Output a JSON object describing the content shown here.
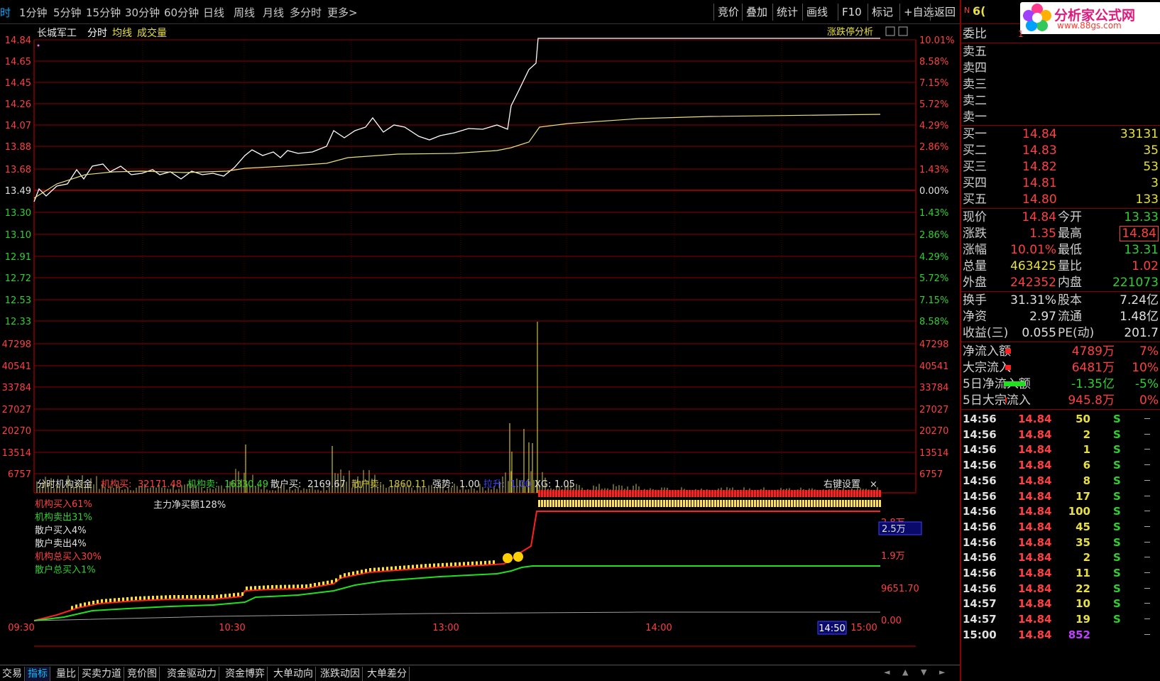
{
  "topbar": {
    "timeframes": [
      "时",
      "1分钟",
      "5分钟",
      "15分钟",
      "30分钟",
      "60分钟",
      "日线",
      "周线",
      "月线",
      "多分时",
      "更多>"
    ],
    "buttons": [
      "竞价",
      "叠加",
      "统计",
      "画线",
      "F10",
      "标记",
      "+自选",
      "返回"
    ]
  },
  "chart": {
    "stock_name": "长城军工",
    "tab_fenshi": "分时",
    "tab_junxian": "均线",
    "tab_volume": "成交量",
    "limit_analysis": "涨跌停分析",
    "price_ticks": [
      "14.84",
      "14.65",
      "14.45",
      "14.26",
      "14.07",
      "13.88",
      "13.68",
      "13.49",
      "13.30",
      "13.10",
      "12.91",
      "12.72",
      "12.53",
      "12.33"
    ],
    "pct_ticks": [
      "10.01%",
      "8.58%",
      "7.15%",
      "5.72%",
      "4.29%",
      "2.86%",
      "1.43%",
      "0.00%",
      "1.43%",
      "2.86%",
      "4.29%",
      "5.72%",
      "7.15%",
      "8.58%"
    ],
    "vol_ticks": [
      "47298",
      "40541",
      "33784",
      "27027",
      "20270",
      "13514",
      "6757"
    ],
    "time_ticks": [
      "09:30",
      "10:30",
      "13:00",
      "14:00"
    ],
    "time_end": "15:00",
    "cursor_time": "14:50",
    "indicator": {
      "name": "分时机构资金",
      "inst_buy_label": "机构买:",
      "inst_buy": "32171.48",
      "inst_sell_label": "机构卖:",
      "inst_sell": "16330.49",
      "retail_buy_label": "散户买:",
      "retail_buy": "2169.67",
      "retail_sell_label": "散户卖:",
      "retail_sell": "1860.11",
      "strength_label": "强势:",
      "strength": "1.00",
      "pull_label": "拉升:",
      "pull": "1.00",
      "xg_label": "XG:",
      "xg": "1.05",
      "settings": "右键设置",
      "close": "×",
      "legend": [
        "机构买入61%",
        "机构卖出31%",
        "散户买入4%",
        "散户卖出4%",
        "机构总买入30%",
        "散户总买入1%"
      ],
      "main_net": "主力净买额128%",
      "y_ticks": [
        "2.8万",
        "1.9万",
        "9651.70",
        "0.00"
      ],
      "y_highlight": "2.5万"
    }
  },
  "panel": {
    "code_prefix": "N",
    "code": "6(",
    "logo_title": "分析家公式网",
    "logo_url": "www.88gs.com",
    "weibi_label": "委比",
    "weibi_value": "1",
    "sell": [
      {
        "label": "卖五"
      },
      {
        "label": "卖四"
      },
      {
        "label": "卖三"
      },
      {
        "label": "卖二"
      },
      {
        "label": "卖一"
      }
    ],
    "buy": [
      {
        "label": "买一",
        "price": "14.84",
        "vol": "33131"
      },
      {
        "label": "买二",
        "price": "14.83",
        "vol": "35"
      },
      {
        "label": "买三",
        "price": "14.82",
        "vol": "53"
      },
      {
        "label": "买四",
        "price": "14.81",
        "vol": "3"
      },
      {
        "label": "买五",
        "price": "14.80",
        "vol": "133"
      }
    ],
    "quote": [
      {
        "l1": "现价",
        "v1": "14.84",
        "l2": "今开",
        "v2": "13.33"
      },
      {
        "l1": "涨跌",
        "v1": "1.35",
        "l2": "最高",
        "v2": "14.84"
      },
      {
        "l1": "涨幅",
        "v1": "10.01%",
        "l2": "最低",
        "v2": "13.31"
      },
      {
        "l1": "总量",
        "v1": "463425",
        "l2": "量比",
        "v2": "1.02"
      },
      {
        "l1": "外盘",
        "v1": "242352",
        "l2": "内盘",
        "v2": "221073"
      }
    ],
    "info": [
      {
        "l1": "换手",
        "v1": "31.31%",
        "l2": "股本",
        "v2": "7.24亿"
      },
      {
        "l1": "净资",
        "v1": "2.97",
        "l2": "流通",
        "v2": "1.48亿"
      },
      {
        "l1": "收益(三)",
        "v1": "0.055",
        "l2": "PE(动)",
        "v2": "201.7"
      }
    ],
    "flow": [
      {
        "label": "净流入额",
        "value": "4789万",
        "pct": "7%"
      },
      {
        "label": "大宗流入",
        "value": "6481万",
        "pct": "10%"
      },
      {
        "label": "5日净流入额",
        "value": "-1.35亿",
        "pct": "-5%"
      },
      {
        "label": "5日大宗流入",
        "value": "945.8万",
        "pct": "0%"
      }
    ],
    "ticks": [
      {
        "time": "14:56",
        "price": "14.84",
        "vol": "50",
        "side": "S"
      },
      {
        "time": "14:56",
        "price": "14.84",
        "vol": "2",
        "side": "S"
      },
      {
        "time": "14:56",
        "price": "14.84",
        "vol": "1",
        "side": "S"
      },
      {
        "time": "14:56",
        "price": "14.84",
        "vol": "6",
        "side": "S"
      },
      {
        "time": "14:56",
        "price": "14.84",
        "vol": "8",
        "side": "S"
      },
      {
        "time": "14:56",
        "price": "14.84",
        "vol": "17",
        "side": "S"
      },
      {
        "time": "14:56",
        "price": "14.84",
        "vol": "100",
        "side": "S"
      },
      {
        "time": "14:56",
        "price": "14.84",
        "vol": "45",
        "side": "S"
      },
      {
        "time": "14:56",
        "price": "14.84",
        "vol": "35",
        "side": "S"
      },
      {
        "time": "14:56",
        "price": "14.84",
        "vol": "2",
        "side": "S"
      },
      {
        "time": "14:56",
        "price": "14.84",
        "vol": "11",
        "side": "S"
      },
      {
        "time": "14:56",
        "price": "14.84",
        "vol": "22",
        "side": "S"
      },
      {
        "time": "14:57",
        "price": "14.84",
        "vol": "10",
        "side": "S"
      },
      {
        "time": "14:57",
        "price": "14.84",
        "vol": "19",
        "side": "S"
      },
      {
        "time": "15:00",
        "price": "14.84",
        "vol": "852",
        "side": ""
      }
    ]
  },
  "bottombar": [
    "交易",
    "指标",
    "量比",
    "买卖力道",
    "竞价图",
    "资金驱动力",
    "资金博弈",
    "大单动向",
    "涨跌动因",
    "大单差分"
  ],
  "colors": {
    "grid": "#8b0000",
    "price": "#ffffff",
    "avg": "#e8e080",
    "vol": "#c8c040",
    "inst": "#ff2020",
    "retail": "#20e020"
  }
}
